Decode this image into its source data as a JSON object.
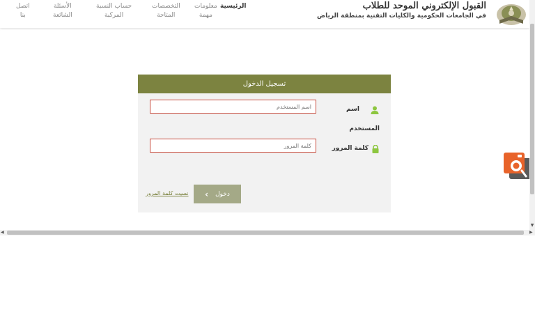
{
  "brand": {
    "title": "القبول الإلكتروني الموحد للطلاب",
    "subtitle": "في الجامعات الحكومية والكليات التقنية بمنطقة الرياض"
  },
  "nav": {
    "home": "الرئيسية",
    "info_l1": "معلومات",
    "info_l2": "مهمة",
    "majors_l1": "التخصصات",
    "majors_l2": "المتاحة",
    "calc_l1": "حساب النسبة",
    "calc_l2": "المركبة",
    "faq_l1": "الأسئلة",
    "faq_l2": "الشائعة",
    "contact_l1": "اتصل",
    "contact_l2": "بنا"
  },
  "login": {
    "title": "تسجيل الدخول",
    "username_label_l1": "اسم",
    "username_label_l2": "المستخدم",
    "username_placeholder": "اسم المستخدم",
    "password_label": "كلمة المرور",
    "password_placeholder": "كلمة المرور",
    "submit_label": "دخول",
    "forgot_label": "نسيت كلمة المرور"
  },
  "colors": {
    "accent": "#7c8340",
    "button": "#a4a987",
    "input_border": "#c74b3d",
    "user_icon": "#8dc63f",
    "widget": "#e8632a"
  },
  "icons": {
    "logo": "quran-book-logo",
    "user": "user-icon",
    "lock": "lock-icon",
    "submit": "chevron-right-icon",
    "widget": "camera-widget-icon"
  }
}
